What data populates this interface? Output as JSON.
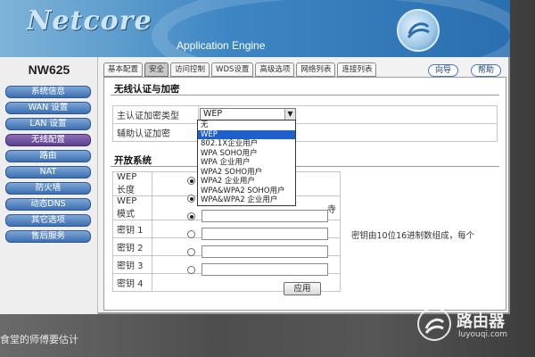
{
  "header": {
    "logo": "Netcore",
    "subtitle": "Application Engine"
  },
  "sidebar": {
    "model": "NW625",
    "items": [
      {
        "label": "系统信息",
        "active": false
      },
      {
        "label": "WAN 设置",
        "active": false
      },
      {
        "label": "LAN 设置",
        "active": false
      },
      {
        "label": "无线配置",
        "active": true
      },
      {
        "label": "路由",
        "active": false
      },
      {
        "label": "NAT",
        "active": false
      },
      {
        "label": "防火墙",
        "active": false
      },
      {
        "label": "动态DNS",
        "active": false
      },
      {
        "label": "其它选项",
        "active": false
      },
      {
        "label": "售后服务",
        "active": false
      }
    ]
  },
  "tabs": [
    {
      "label": "基本配置",
      "active": false
    },
    {
      "label": "安全",
      "active": true
    },
    {
      "label": "访问控制",
      "active": false
    },
    {
      "label": "WDS设置",
      "active": false
    },
    {
      "label": "高级选项",
      "active": false
    },
    {
      "label": "网络列表",
      "active": false
    },
    {
      "label": "连接列表",
      "active": false
    }
  ],
  "top_buttons": {
    "wizard": "向导",
    "help": "帮助"
  },
  "section_auth": {
    "title": "无线认证与加密",
    "primary_label": "主认证加密类型",
    "primary_value": "WEP",
    "secondary_label": "辅助认证加密"
  },
  "dropdown_options": [
    {
      "label": "无",
      "selected": false
    },
    {
      "label": "WEP",
      "selected": true
    },
    {
      "label": "802.1X企业用户",
      "selected": false
    },
    {
      "label": "WPA SOHO用户",
      "selected": false
    },
    {
      "label": "WPA 企业用户",
      "selected": false
    },
    {
      "label": "WPA2 SOHO用户",
      "selected": false
    },
    {
      "label": "WPA2 企业用户",
      "selected": false
    },
    {
      "label": "WPA&WPA2 SOHO用户",
      "selected": false
    },
    {
      "label": "WPA&WPA2 企业用户",
      "selected": false
    }
  ],
  "section_open": {
    "title": "开放系统",
    "wep_length_label": "WEP 长度",
    "wep_mode_label": "WEP 模式",
    "wep_mode_fragment": "寺",
    "keys": [
      {
        "label": "密钥 1",
        "selected": true
      },
      {
        "label": "密钥 2",
        "selected": false
      },
      {
        "label": "密钥 3",
        "selected": false
      },
      {
        "label": "密钥 4",
        "selected": false
      }
    ],
    "note_line1": "密钥由10位16进制数组成，每个",
    "apply": "应用"
  },
  "caption": "食堂的师傅要估计",
  "watermark": {
    "title": "路由器",
    "url": "luyouqi.com"
  }
}
